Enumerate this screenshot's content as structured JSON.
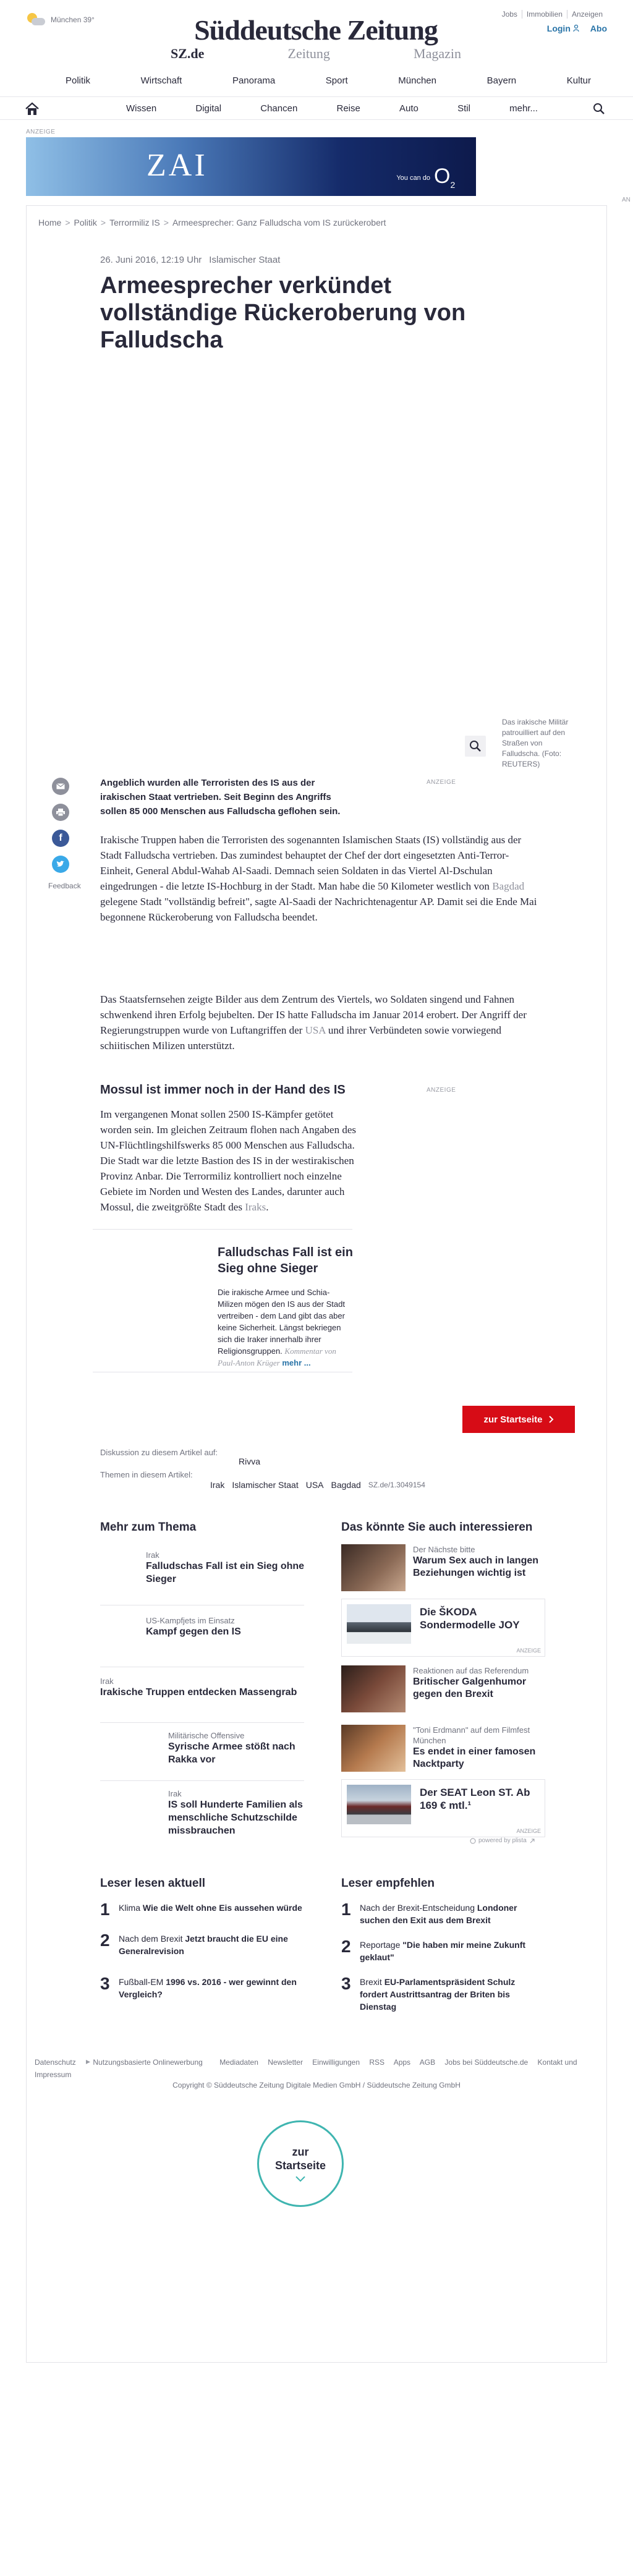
{
  "header": {
    "weather": "München 39°",
    "logo": "Süddeutsche Zeitung",
    "sublinks": [
      "SZ.de",
      "Zeitung",
      "Magazin"
    ],
    "toplinks": [
      "Jobs",
      "Immobilien",
      "Anzeigen"
    ],
    "login": "Login",
    "abo": "Abo",
    "nav_primary": [
      "Politik",
      "Wirtschaft",
      "Panorama",
      "Sport",
      "München",
      "Bayern",
      "Kultur"
    ],
    "nav_secondary": [
      "Wissen",
      "Digital",
      "Chancen",
      "Reise",
      "Auto",
      "Stil",
      "mehr..."
    ]
  },
  "ad": {
    "label": "ANZEIGE",
    "brand": "ZAI",
    "tagline": "You can do",
    "logo": "O",
    "logo_sub": "2",
    "right_label": "AN"
  },
  "article": {
    "breadcrumb": [
      "Home",
      "Politik",
      "Terrormiliz IS",
      "Armeesprecher: Ganz Falludscha vom IS zurückerobert"
    ],
    "date": "26. Juni 2016, 12:19 Uhr",
    "category": "Islamischer Staat",
    "headline": "Armeesprecher verkündet vollständige Rückeroberung von Falludscha",
    "caption": "Das irakische Militär patrouilliert auf den Straßen von Falludscha. (Foto: REUTERS)",
    "lead": "Angeblich wurden alle Terroristen des IS aus der irakischen Staat vertrieben. Seit Beginn des Angriffs sollen 85 000 Menschen aus Falludscha geflohen sein.",
    "ad_label": "ANZEIGE",
    "p1": {
      "a": "Irakische Truppen haben die Terroristen des sogenannten Islamischen Staats (IS) vollständig aus der Stadt Falludscha vertrieben. Das zumindest behauptet der Chef der dort eingesetzten Anti-Terror-Einheit, General Abdul-Wahab Al-Saadi. Demnach seien Soldaten in das Viertel Al-Dschulan eingedrungen - die letzte IS-Hochburg in der Stadt. Man habe die 50 Kilometer westlich von ",
      "link": "Bagdad",
      "b": " gelegene Stadt \"vollständig befreit\", sagte Al-Saadi der Nachrichtenagentur AP. Damit sei die Ende Mai begonnene Rückeroberung von Falludscha beendet."
    },
    "p2": {
      "a": "Das Staatsfernsehen zeigte Bilder aus dem Zentrum des Viertels, wo Soldaten singend und Fahnen schwenkend ihren Erfolg bejubelten. Der IS hatte Falludscha im Januar 2014 erobert. Der Angriff der Regierungstruppen wurde von Luftangriffen der ",
      "link": "USA",
      "b": " und ihrer Verbündeten sowie vorwiegend schiitischen Milizen unterstützt."
    },
    "subhead": "Mossul ist immer noch in der Hand des IS",
    "p3": {
      "a": "Im vergangenen Monat sollen 2500 IS-Kämpfer getötet worden sein. Im gleichen Zeitraum flohen nach Angaben des UN-Flüchtlingshilfswerks 85 000 Menschen aus Falludscha. Die Stadt war die letzte Bastion des IS in der westirakischen Provinz Anbar. Die Terrormiliz kontrolliert noch einzelne Gebiete im Norden und Westen des Landes, darunter auch Mossul, die zweitgrößte Stadt des ",
      "link": "Iraks",
      "b": "."
    },
    "feedback": "Feedback"
  },
  "teaser": {
    "title": "Falludschas Fall ist ein Sieg ohne Sieger",
    "text": "Die irakische Armee und Schia-Milizen mögen den IS aus der Stadt vertreiben - dem Land gibt das aber keine Sicherheit. Längst bekriegen sich die Iraker innerhalb ihrer Religionsgruppen.",
    "kommentar": "Kommentar von Paul-Anton Krüger",
    "mehr": "mehr ..."
  },
  "startseite_button": "zur Startseite",
  "discussion": {
    "label": "Diskussion zu diesem Artikel auf:",
    "platform": "Rivva",
    "themen_label": "Themen in diesem Artikel:",
    "themen": [
      "Irak",
      "Islamischer Staat",
      "USA",
      "Bagdad"
    ],
    "permalink": "SZ.de/1.3049154"
  },
  "mehr_zum_thema": {
    "heading": "Mehr zum Thema",
    "items": [
      {
        "kicker": "Irak",
        "title": "Falludschas Fall ist ein Sieg ohne Sieger"
      },
      {
        "kicker": "US-Kampfjets im Einsatz",
        "title": "Kampf gegen den IS"
      },
      {
        "kicker": "Irak",
        "title": "Irakische Truppen entdecken Massengrab"
      },
      {
        "kicker": "Militärische Offensive",
        "title": "Syrische Armee stößt nach Rakka vor"
      },
      {
        "kicker": "Irak",
        "title": "IS soll Hunderte Familien als menschliche Schutzschilde missbrauchen"
      }
    ]
  },
  "interessieren": {
    "heading": "Das könnte Sie auch interessieren",
    "items": [
      {
        "kicker": "Der Nächste bitte",
        "title": "Warum Sex auch in langen Beziehungen wichtig ist"
      },
      {
        "ad": true,
        "title": "Die ŠKODA Sondermodelle JOY",
        "label": "ANZEIGE"
      },
      {
        "kicker": "Reaktionen auf das Referendum",
        "title": "Britischer Galgenhumor gegen den Brexit"
      },
      {
        "kicker": "\"Toni Erdmann\" auf dem Filmfest München",
        "title": "Es endet in einer famosen Nacktparty"
      },
      {
        "ad": true,
        "title": "Der SEAT Leon ST. Ab 169 € mtl.¹",
        "label": "ANZEIGE"
      }
    ],
    "powered": "powered by plista"
  },
  "leser_lesen": {
    "heading": "Leser lesen aktuell",
    "items": [
      {
        "n": "1",
        "pre": "Klima ",
        "title": "Wie die Welt ohne Eis aussehen würde",
        "post": ""
      },
      {
        "n": "2",
        "pre": "Nach dem Brexit ",
        "title": "Jetzt braucht die EU eine Generalrevision",
        "post": ""
      },
      {
        "n": "3",
        "pre": "Fußball-EM ",
        "title": "1996 vs. 2016 - wer gewinnt den Vergleich?",
        "post": ""
      }
    ]
  },
  "leser_empfehlen": {
    "heading": "Leser empfehlen",
    "items": [
      {
        "n": "1",
        "pre": "Nach der Brexit-Entscheidung ",
        "title": "Londoner suchen den Exit aus dem Brexit",
        "post": ""
      },
      {
        "n": "2",
        "pre": "Reportage ",
        "title": "\"Die haben mir meine Zukunft geklaut\"",
        "post": ""
      },
      {
        "n": "3",
        "pre": "Brexit ",
        "title": "EU-Parlamentspräsident Schulz fordert Austrittsantrag der Briten bis Dienstag",
        "post": ""
      }
    ]
  },
  "footer": {
    "links": [
      "Datenschutz",
      "Nutzungsbasierte Onlinewerbung",
      "Mediadaten",
      "Newsletter",
      "Einwilligungen",
      "RSS",
      "Apps",
      "AGB",
      "Jobs bei Süddeutsche.de",
      "Kontakt und Impressum"
    ],
    "copyright": "Copyright © Süddeutsche Zeitung Digitale Medien GmbH / Süddeutsche Zeitung GmbH"
  },
  "circle_button": {
    "l1": "zur",
    "l2": "Startseite"
  },
  "colors": {
    "accent_red": "#d70c16",
    "link_blue": "#2974a8",
    "teal": "#3fb5b0",
    "text": "#29293a"
  }
}
